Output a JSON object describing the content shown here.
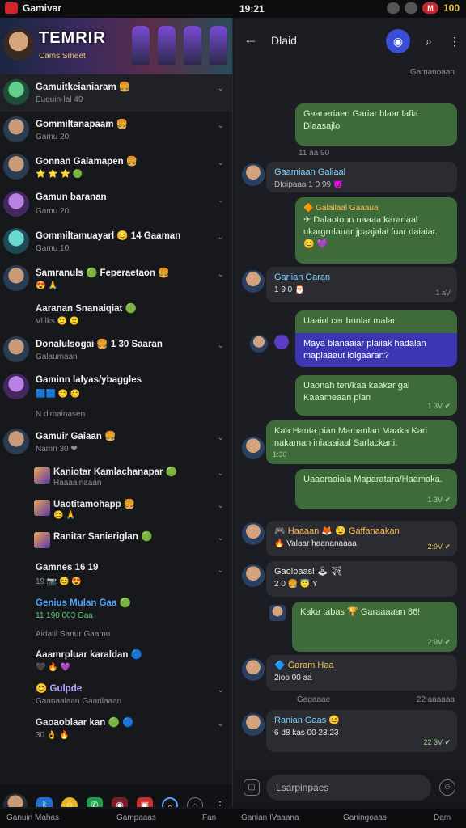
{
  "status": {
    "app_name": "Gamivar",
    "time": "19:21",
    "battery": "100"
  },
  "banner": {
    "title": "TEMRIR",
    "subtitle": "Cams Smeet"
  },
  "chats": [
    {
      "name": "Gamuitkeianiaram 🍔",
      "sub": "Euquin·lal 49",
      "avatar": "g"
    },
    {
      "name": "Gommiltanapaam 🍔",
      "sub": "Gamu 20",
      "avatar": "u"
    },
    {
      "name": "Gonnan Galamapen 🍔",
      "sub": "⭐ ⭐ ⭐ 🟢",
      "avatar": "u"
    },
    {
      "name": "Gamun baranan",
      "sub": "Gamu 20",
      "avatar": "p"
    },
    {
      "name": "Gommiltamuayarl 😊 14 Gaaman",
      "sub": "Gamu 10",
      "avatar": "c"
    },
    {
      "name": "Samranuls 🟢 Feperaetaon 🍔",
      "sub": "😍 🙏",
      "avatar": "u"
    }
  ],
  "plain1": {
    "name": "Aaranan Snanaiqiat 🟢",
    "sub": "Vl.lks 🙂 🙁"
  },
  "chats2": [
    {
      "name": "Donalulsogai 🍔 1 30 Saaran",
      "sub": "Galaumaan"
    },
    {
      "name": "Gaminn lalyas/ybaggles",
      "sub": "🟦🟦 😊 😊"
    }
  ],
  "section1": "N dimainasen",
  "chat3": {
    "name": "Gamuir Gaiaan 🍔",
    "sub": "Namn 30 ❤"
  },
  "subs": [
    {
      "name": "Kaniotar Kamlachanapar 🟢",
      "sub": "Haaaainaaan"
    },
    {
      "name": "Uaotitamohapp 🍔",
      "sub": "😊 🙏"
    },
    {
      "name": "Ranitar Sanieriglan 🟢",
      "sub": ""
    }
  ],
  "plain2": [
    {
      "name": "Gamnes 16 19",
      "sub": "19 📷 😊 😍"
    },
    {
      "name": "Genius Mulan Gaa 🟢",
      "sub": "11 190 003 Gaa"
    },
    {
      "name": "Aidatil Sanur Gaamu",
      "sub": ""
    },
    {
      "name": "Aaamrpluar karaldan 🔵",
      "sub": "🖤 🔥 💜"
    },
    {
      "name": "😊 Gulpde",
      "sub": "Gaanaalaan Gaarilaaan"
    },
    {
      "name": "Gaoaoblaar kan 🟢 🔵",
      "sub": "30 👌 🔥"
    }
  ],
  "leftbar_icons": [
    "profile",
    "bluetooth",
    "emoji",
    "whatsapp",
    "camera",
    "bag",
    "search",
    "more",
    "menu"
  ],
  "right": {
    "header_title": "Dlaid",
    "top_label": "Gamanoaan",
    "messages": [
      {
        "text": "Gaaneriaen Gariar blaar lafia Dlaasajlo",
        "time": "11 aa 90",
        "side": "out"
      },
      {
        "text": "Gaamiaan Galiaal",
        "meta": "Dloipaaa 1 0 99 😈",
        "side": "in"
      },
      {
        "text": "✈ Dalaotonn naaaa karanaal ukargrnlauar jpaajalai fuar daiaiar. 😊 💜",
        "meta": "🔶 Galailaal Gaaaua",
        "side": "out"
      },
      {
        "text": "Gariian Garan",
        "meta": "1 9 0 🎅",
        "side": "in",
        "time": "1 aV"
      },
      {
        "text": "Uaaiol cer bunlar malar",
        "side": "out"
      },
      {
        "text": "Maya blanaaiar plaiiak hadalan maplaaaut loigaaran?",
        "side": "hl"
      },
      {
        "text": "Uaonah ten/kaa kaakar gal Kaaameaan plan",
        "time": "1 3V ✔",
        "side": "out"
      },
      {
        "text": "Kaa Hanta pian Mamanlan Maaka Kari nakaman iniaaaiaal Sarlackani.",
        "time": "1:30",
        "side": "out"
      },
      {
        "text": "Uaaoraaiala Maparatara/Haamaka.",
        "time": "1 3V ✔",
        "side": "out"
      },
      {
        "text": "🎮 Haaaan 🦊 😉 Gaffanaakan",
        "meta": "🔥 Valaar haananaaaa",
        "side": "in",
        "time": "2:9V ✔"
      },
      {
        "text": "Gaoloaasl 🕹 ✈",
        "meta": "2 0 🍔 😇 Y",
        "side": "in"
      },
      {
        "text": "Kaka tabas 🏆 Garaaaaan 86!",
        "side": "out",
        "time": "2:9V ✔"
      },
      {
        "text": "🔷 Garam Haa",
        "meta": "2ioo 00 aa",
        "side": "in"
      },
      {
        "text": "Ranian Gaas 😊",
        "meta": "6 d8 kas 00 23.23",
        "side": "in",
        "time": "22 3V ✔"
      }
    ],
    "day_left": "Gagaaae",
    "day_right": "22 aaaaaa",
    "input_placeholder": "Lsarpinpaes"
  },
  "tabs": {
    "t1": "Ganuin Mahas",
    "t2": "Gampaaas",
    "t3": "Fan",
    "t4": "Ganian IVaaana",
    "t5": "Ganingoaas",
    "t6": "Dam"
  }
}
